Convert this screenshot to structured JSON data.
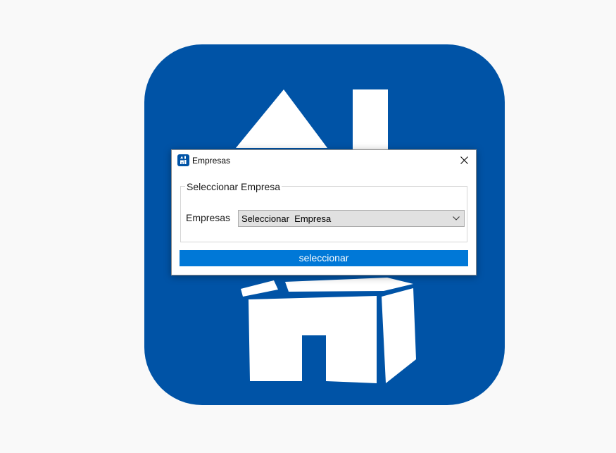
{
  "window": {
    "title": "Empresas",
    "icon": "company-app-icon"
  },
  "titlebar": {
    "close_icon": "close-icon"
  },
  "group": {
    "legend": "Seleccionar Empresa"
  },
  "form": {
    "label": "Empresas",
    "select_value": "Seleccionar  Empresa",
    "dropdown_icon": "chevron-down-icon"
  },
  "actions": {
    "select_label": "seleccionar"
  },
  "colors": {
    "brand_blue": "#0053a6",
    "button_blue": "#0078d7"
  }
}
